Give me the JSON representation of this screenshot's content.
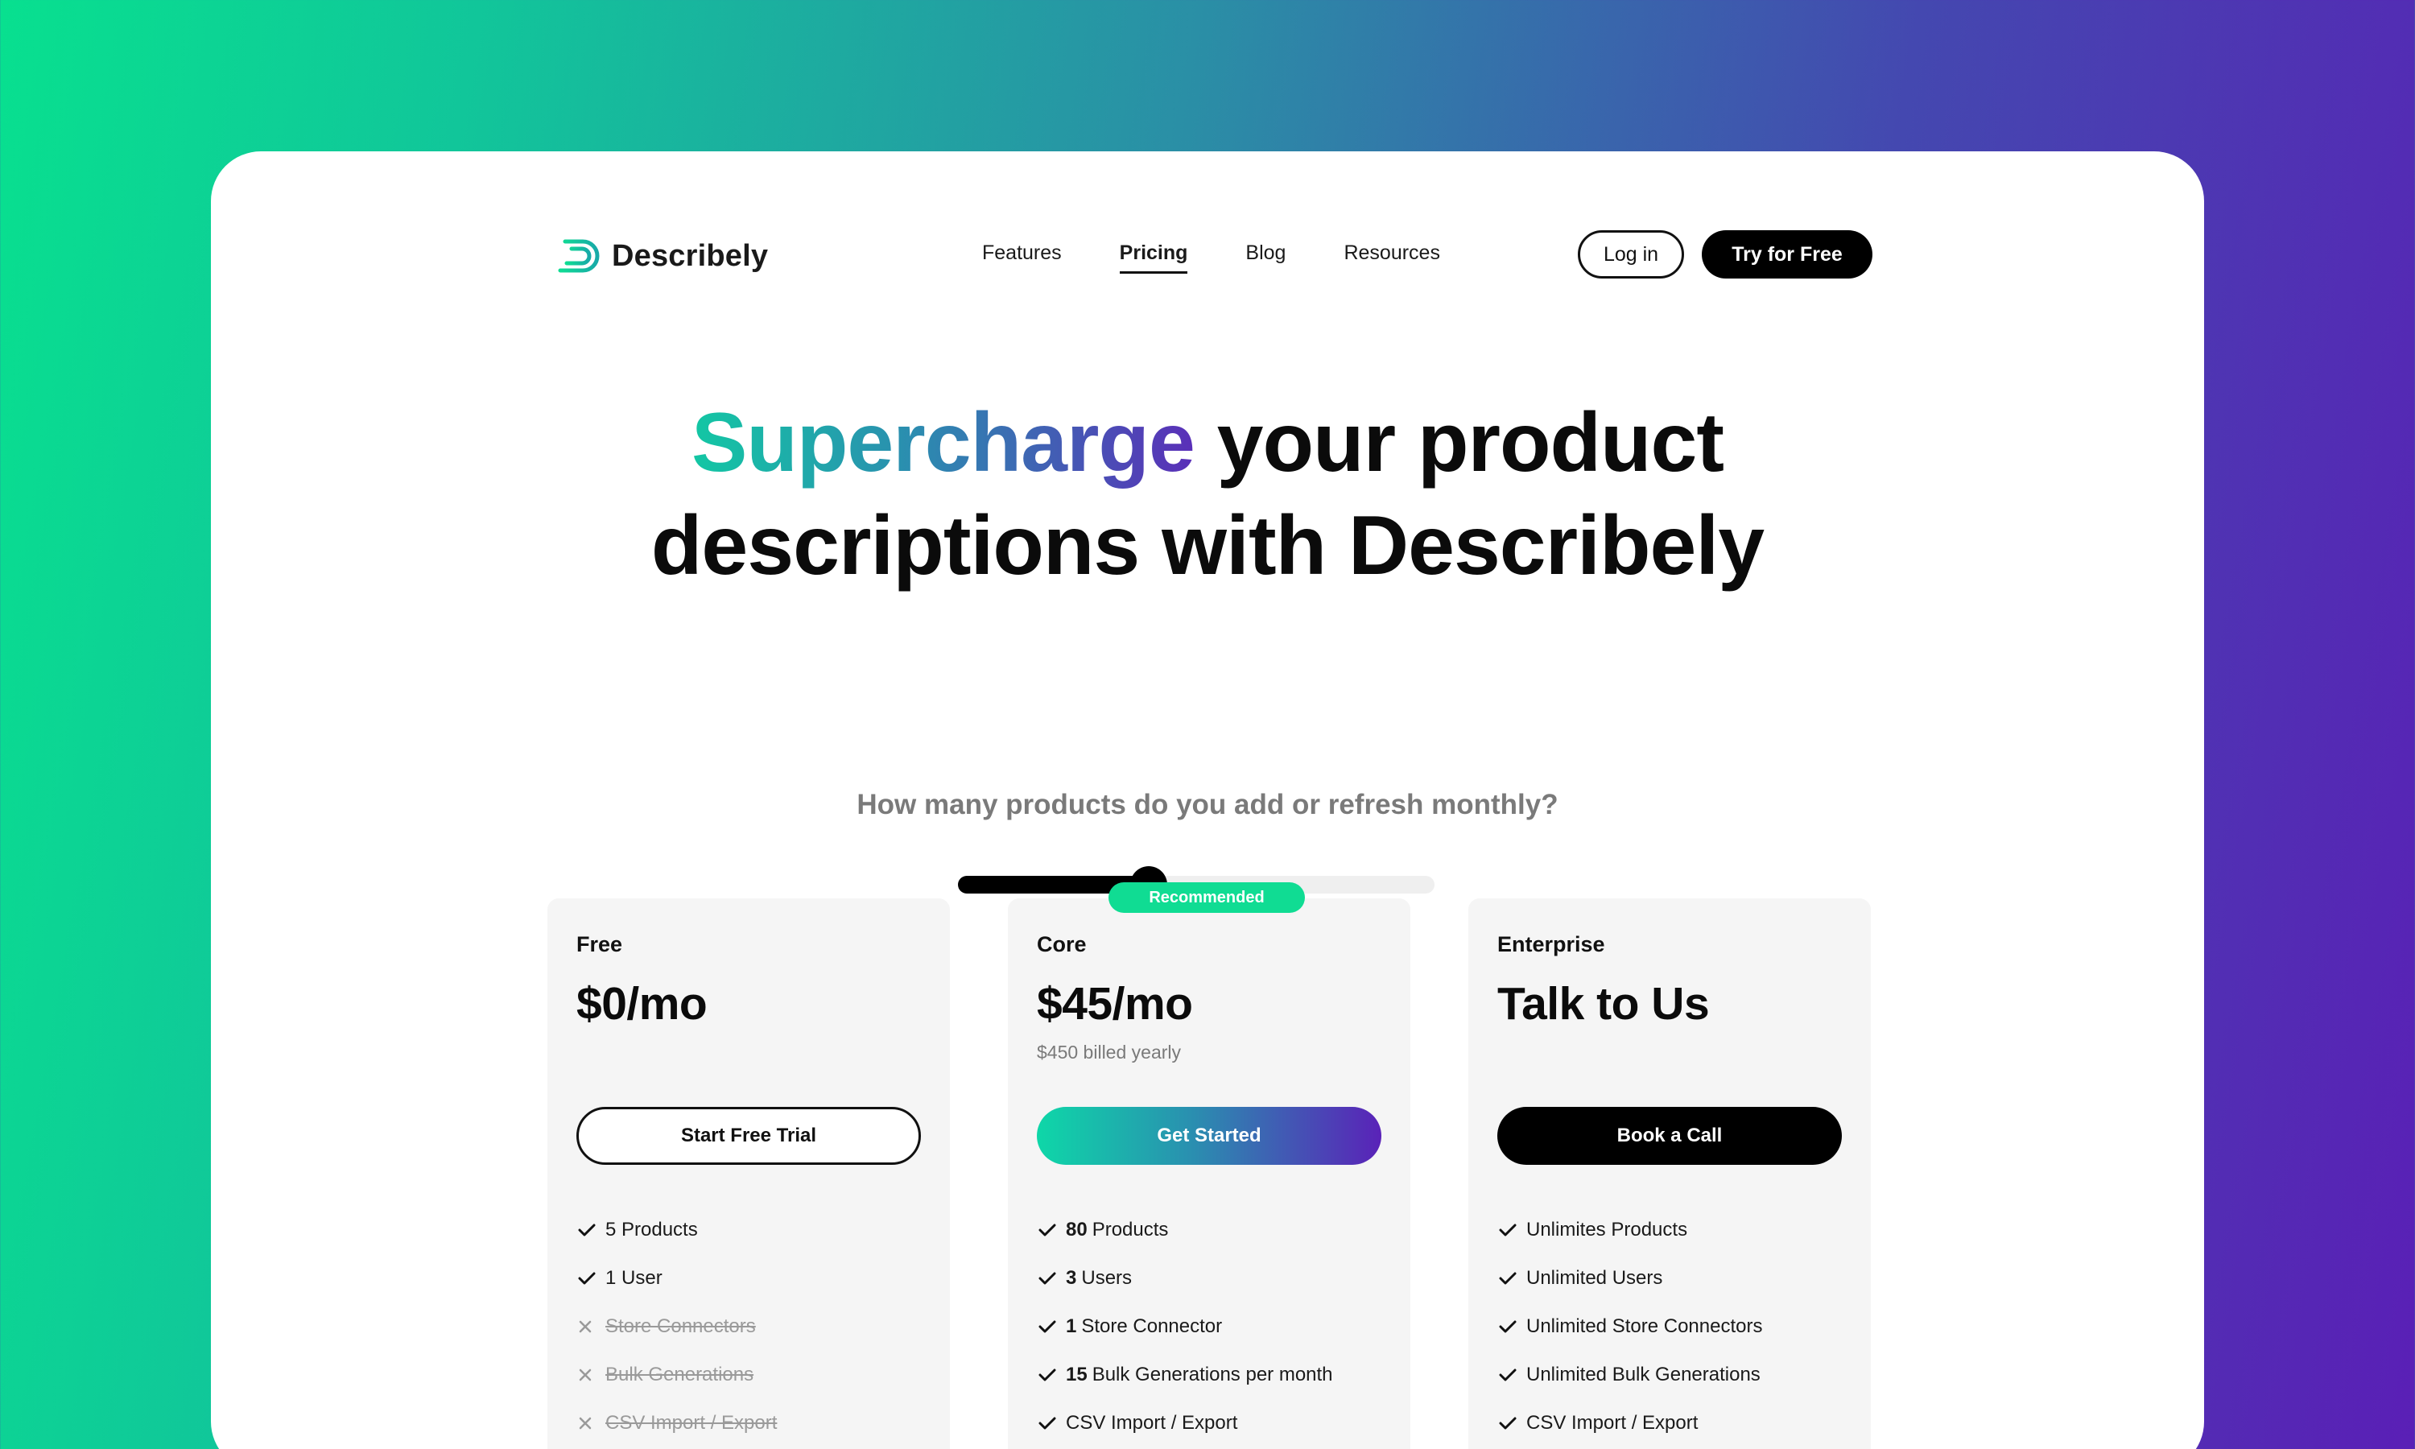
{
  "brand": {
    "name": "Describely",
    "accent": "#10dc93",
    "purple": "#5a22b8"
  },
  "nav": {
    "links": [
      {
        "label": "Features"
      },
      {
        "label": "Pricing",
        "active": true
      },
      {
        "label": "Blog"
      },
      {
        "label": "Resources"
      }
    ],
    "login_label": "Log in",
    "try_label": "Try for Free"
  },
  "hero": {
    "highlight": "Supercharge",
    "rest_line1": " your product",
    "line2": "descriptions with Describely",
    "question": "How many products do you add or refresh monthly?"
  },
  "slider": {
    "value": "80",
    "min": 0,
    "max": 200
  },
  "plans": [
    {
      "name": "Free",
      "price": "$0/mo",
      "billed": "",
      "button": "Start Free Trial",
      "features": [
        {
          "bold": "",
          "text": "5 Products",
          "included": true
        },
        {
          "bold": "",
          "text": "1 User",
          "included": true
        },
        {
          "bold": "",
          "text": "Store Connectors",
          "included": false
        },
        {
          "bold": "",
          "text": "Bulk Generations",
          "included": false
        },
        {
          "bold": "",
          "text": "CSV Import / Export",
          "included": false
        }
      ]
    },
    {
      "name": "Core",
      "badge": "Recommended",
      "price": "$45/mo",
      "billed": "$450 billed yearly",
      "button": "Get Started",
      "features": [
        {
          "bold": "80",
          "text": "Products",
          "included": true
        },
        {
          "bold": "3",
          "text": "Users",
          "included": true
        },
        {
          "bold": "1",
          "text": "Store Connector",
          "included": true
        },
        {
          "bold": "15",
          "text": "Bulk Generations per month",
          "included": true
        },
        {
          "bold": "",
          "text": "CSV Import / Export",
          "included": true
        }
      ]
    },
    {
      "name": "Enterprise",
      "price": "Talk to Us",
      "billed": "",
      "button": "Book a Call",
      "features": [
        {
          "bold": "",
          "text": "Unlimites Products",
          "included": true
        },
        {
          "bold": "",
          "text": "Unlimited Users",
          "included": true
        },
        {
          "bold": "",
          "text": "Unlimited Store Connectors",
          "included": true
        },
        {
          "bold": "",
          "text": "Unlimited Bulk Generations",
          "included": true
        },
        {
          "bold": "",
          "text": "CSV Import / Export",
          "included": true
        }
      ]
    }
  ],
  "icons": {
    "check": "check-icon",
    "cross": "x-icon",
    "logo": "describely-logo-icon"
  }
}
